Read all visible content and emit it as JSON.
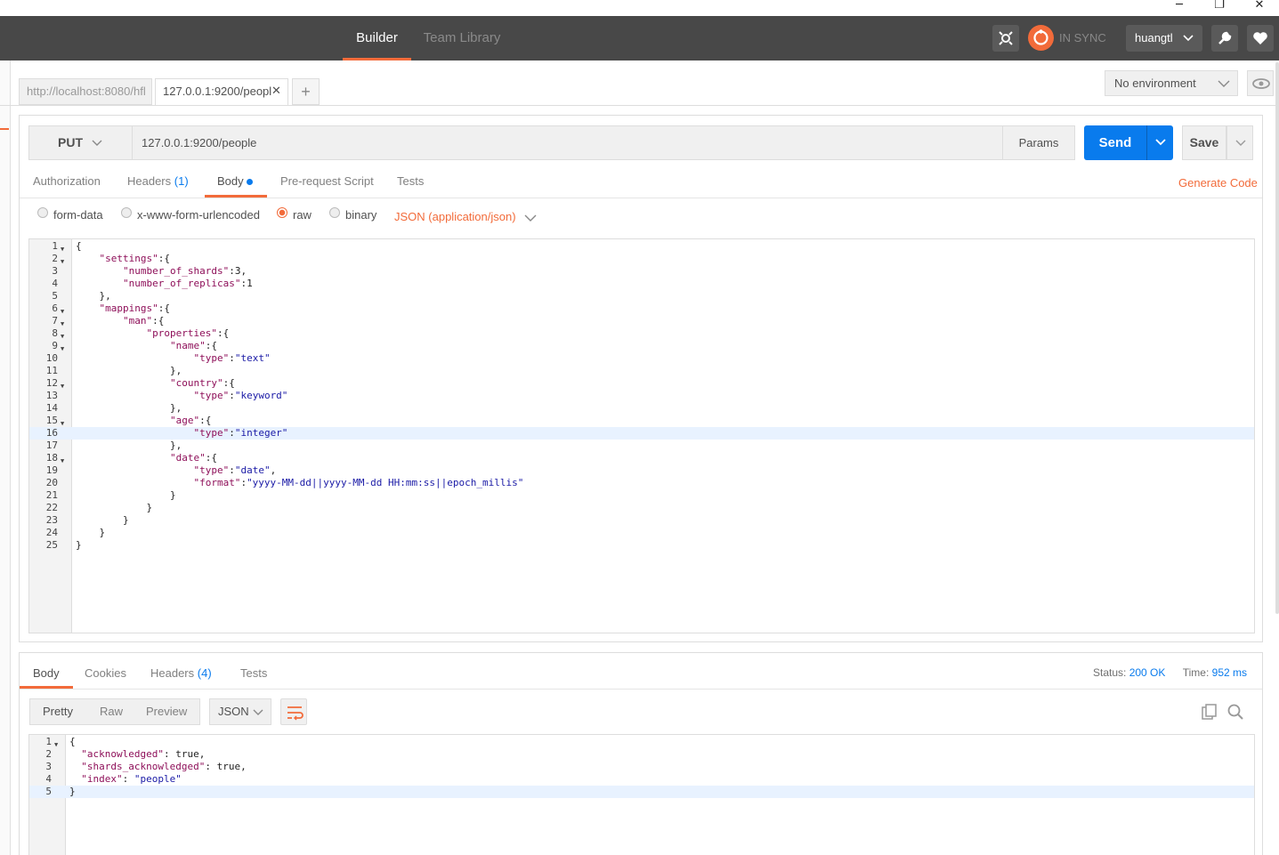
{
  "window": {
    "minimize": "─",
    "restore": "❐",
    "close": "✕"
  },
  "header": {
    "tabs": [
      "Builder",
      "Team Library"
    ],
    "sync_text": "IN SYNC",
    "user": "huangtl"
  },
  "tabs": {
    "tab1": "http://localhost:8080/hfl",
    "tab2": "127.0.0.1:9200/peopl",
    "add": "+",
    "environment": "No environment"
  },
  "request": {
    "method": "PUT",
    "url": "127.0.0.1:9200/people",
    "params": "Params",
    "send": "Send",
    "save": "Save",
    "tabs": {
      "authorization": "Authorization",
      "headers": "Headers",
      "headers_count": "(1)",
      "body": "Body",
      "pre_request": "Pre-request Script",
      "tests": "Tests"
    },
    "generate_code": "Generate Code",
    "body_types": [
      "form-data",
      "x-www-form-urlencoded",
      "raw",
      "binary"
    ],
    "selected_body_type": "raw",
    "content_type": "JSON (application/json)"
  },
  "editor_lines": [
    "{",
    "    \"settings\":{",
    "        \"number_of_shards\":3,",
    "        \"number_of_replicas\":1",
    "    },",
    "    \"mappings\":{",
    "        \"man\":{",
    "            \"properties\":{",
    "                \"name\":{",
    "                    \"type\":\"text\"",
    "                },",
    "                \"country\":{",
    "                    \"type\":\"keyword\"",
    "                },",
    "                \"age\":{",
    "                    \"type\":\"integer\"",
    "                },",
    "                \"date\":{",
    "                    \"type\":\"date\",",
    "                    \"format\":\"yyyy-MM-dd||yyyy-MM-dd HH:mm:ss||epoch_millis\"",
    "                }",
    "            }",
    "        }",
    "    }",
    "}"
  ],
  "response": {
    "tabs": {
      "body": "Body",
      "cookies": "Cookies",
      "headers": "Headers",
      "headers_count": "(4)",
      "tests": "Tests"
    },
    "status_label": "Status:",
    "status_value": "200 OK",
    "time_label": "Time:",
    "time_value": "952 ms",
    "formats": [
      "Pretty",
      "Raw",
      "Preview"
    ],
    "format_type": "JSON",
    "lines": [
      "{",
      "  \"acknowledged\": true,",
      "  \"shards_acknowledged\": true,",
      "  \"index\": \"people\"",
      "}"
    ]
  }
}
